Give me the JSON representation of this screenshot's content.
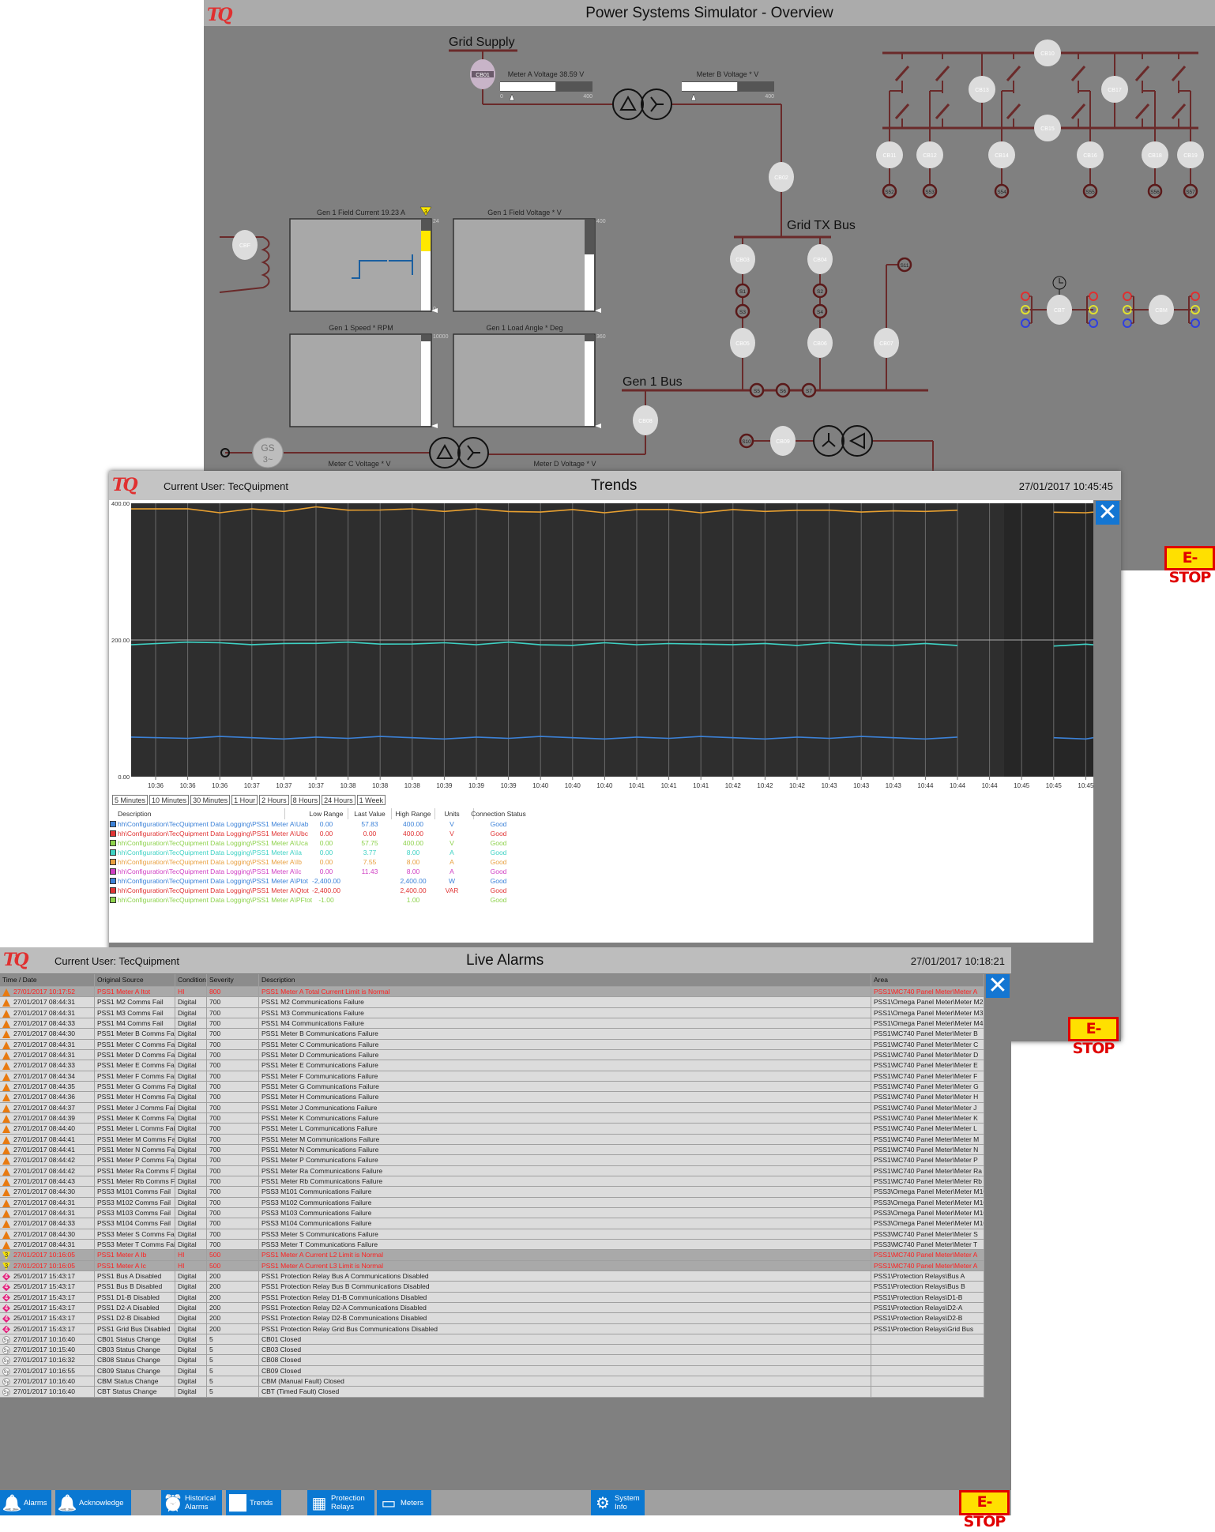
{
  "overview": {
    "logo": "TQ",
    "title": "Power Systems Simulator - Overview",
    "grid_supply_label": "Grid Supply",
    "grid_tx_bus_label": "Grid TX Bus",
    "gen1_bus_label": "Gen 1 Bus",
    "meter_a": {
      "label": "Meter A Voltage 38.59 V",
      "min": "0",
      "max": "400",
      "value": 38.59,
      "fill_fraction": 0.6
    },
    "meter_b": {
      "label": "Meter B Voltage * V",
      "min": "",
      "max": "400",
      "fill_fraction": 0.6
    },
    "meter_c_label": "Meter C Voltage * V",
    "meter_d_label": "Meter D Voltage * V",
    "generator_label": "GS",
    "generator_sub": "3~",
    "gen_panels": [
      {
        "title": "Gen 1 Field Current 19.23 A",
        "max": "24",
        "min": "0",
        "alarm_badge": "3"
      },
      {
        "title": "Gen 1 Field Voltage * V",
        "max": "400",
        "min": ""
      },
      {
        "title": "Gen 1 Speed * RPM",
        "max": "10000",
        "min": ""
      },
      {
        "title": "Gen 1 Load Angle * Deg",
        "max": "360",
        "min": ""
      }
    ],
    "breakers": [
      "CB01",
      "CB02",
      "CB03",
      "CB04",
      "CB05",
      "CB06",
      "CB07",
      "CB08",
      "CB09",
      "CBF",
      "CB10",
      "CB11",
      "CB12",
      "CB13",
      "CB14",
      "CB15",
      "CB16",
      "CB17",
      "CB18",
      "CB19",
      "CBT",
      "CBM"
    ],
    "switches": [
      "S1",
      "S2",
      "S3",
      "S4",
      "S5",
      "S6",
      "S7",
      "S10",
      "S11",
      "S52",
      "S53",
      "S54",
      "S55",
      "S56",
      "S57"
    ],
    "estop": "E-STOP",
    "colors": {
      "bus": "#6a2a2a",
      "breaker": "#dcdcdc",
      "background": "#808080"
    }
  },
  "trends": {
    "logo": "TQ",
    "current_user": "Current User: TecQuipment",
    "title": "Trends",
    "datetime": "27/01/2017 10:45:45",
    "time_buttons": [
      "5 Minutes",
      "10 Minutes",
      "30 Minutes",
      "1 Hour",
      "2 Hours",
      "8 Hours",
      "24 Hours",
      "1 Week"
    ],
    "legend_headers": [
      "Description",
      "Low Range",
      "Last Value",
      "High Range",
      "Units",
      "Connection Status"
    ],
    "legend": [
      {
        "color": "#3c82d8",
        "desc": "hh\\Configuration\\TecQuipment Data Logging\\PSS1 Meter A\\Uab",
        "low": "0.00",
        "last": "57.83",
        "high": "400.00",
        "units": "V",
        "status": "Good"
      },
      {
        "color": "#e03434",
        "desc": "hh\\Configuration\\TecQuipment Data Logging\\PSS1 Meter A\\Ubc",
        "low": "0.00",
        "last": "0.00",
        "high": "400.00",
        "units": "V",
        "status": "Good"
      },
      {
        "color": "#8ed24c",
        "desc": "hh\\Configuration\\TecQuipment Data Logging\\PSS1 Meter A\\Uca",
        "low": "0.00",
        "last": "57.75",
        "high": "400.00",
        "units": "V",
        "status": "Good"
      },
      {
        "color": "#3ed2c4",
        "desc": "hh\\Configuration\\TecQuipment Data Logging\\PSS1 Meter A\\Ia",
        "low": "0.00",
        "last": "3.77",
        "high": "8.00",
        "units": "A",
        "status": "Good"
      },
      {
        "color": "#e8a040",
        "desc": "hh\\Configuration\\TecQuipment Data Logging\\PSS1 Meter A\\Ib",
        "low": "0.00",
        "last": "7.55",
        "high": "8.00",
        "units": "A",
        "status": "Good"
      },
      {
        "color": "#d040c4",
        "desc": "hh\\Configuration\\TecQuipment Data Logging\\PSS1 Meter A\\Ic",
        "low": "0.00",
        "last": "11.43",
        "high": "8.00",
        "units": "A",
        "status": "Good"
      },
      {
        "color": "#3c82d8",
        "desc": "hh\\Configuration\\TecQuipment Data Logging\\PSS1 Meter A\\Ptot",
        "low": "-2,400.00",
        "last": "",
        "high": "2,400.00",
        "units": "W",
        "status": "Good"
      },
      {
        "color": "#e03434",
        "desc": "hh\\Configuration\\TecQuipment Data Logging\\PSS1 Meter A\\Qtot",
        "low": "-2,400.00",
        "last": "",
        "high": "2,400.00",
        "units": "VAR",
        "status": "Good"
      },
      {
        "color": "#8ed24c",
        "desc": "hh\\Configuration\\TecQuipment Data Logging\\PSS1 Meter A\\PFtot",
        "low": "-1.00",
        "last": "",
        "high": "1.00",
        "units": "",
        "status": "Good"
      }
    ],
    "estop": "E-STOP",
    "chart_data": {
      "type": "line",
      "ylim": [
        0,
        400
      ],
      "ytick_labels": [
        "400.00",
        "200.00",
        "0.00"
      ],
      "grid": true,
      "xtick_labels": [
        "10:36",
        "10:36",
        "10:36",
        "10:37",
        "10:37",
        "10:37",
        "10:38",
        "10:38",
        "10:38",
        "10:39",
        "10:39",
        "10:39",
        "10:40",
        "10:40",
        "10:40",
        "10:41",
        "10:41",
        "10:41",
        "10:42",
        "10:42",
        "10:42",
        "10:43",
        "10:43",
        "10:43",
        "10:44",
        "10:44",
        "10:44",
        "10:45",
        "10:45",
        "10:45"
      ],
      "series": [
        {
          "color": "#e8a030",
          "values": [
            390,
            392,
            388,
            391,
            389,
            393,
            390,
            392,
            391,
            389,
            390,
            388,
            389,
            390,
            387,
            389,
            391,
            388,
            390,
            389,
            388,
            390,
            389,
            388,
            389,
            388,
            null,
            null,
            386,
            387
          ]
        },
        {
          "color": "#3ed2c4",
          "values": [
            194,
            195,
            196,
            195,
            194,
            196,
            195,
            194,
            196,
            195,
            194,
            195,
            193,
            194,
            195,
            194,
            193,
            194,
            195,
            194,
            193,
            194,
            193,
            194,
            194,
            193,
            null,
            null,
            193,
            193
          ]
        },
        {
          "color": "#3c82d8",
          "values": [
            57,
            57,
            57,
            57,
            57,
            57,
            57,
            57,
            57,
            57,
            57,
            57,
            57,
            57,
            57,
            57,
            57,
            57,
            57,
            57,
            57,
            57,
            57,
            57,
            57,
            57,
            null,
            null,
            57,
            57
          ]
        }
      ]
    }
  },
  "alarms": {
    "logo": "TQ",
    "current_user": "Current User: TecQuipment",
    "title": "Live Alarms",
    "datetime": "27/01/2017 10:18:21",
    "headers": [
      "Time / Date",
      "Original Source",
      "Condition",
      "Severity",
      "Description",
      "Area"
    ],
    "rows": [
      [
        "warn",
        "27/01/2017 10:17:52",
        "PSS1 Meter A Itot",
        "HI",
        "800",
        "PSS1 Meter A Total Current Limit is Normal",
        "PSS1\\MC740 Panel Meter\\Meter A",
        1
      ],
      [
        "warn",
        "27/01/2017 08:44:31",
        "PSS1 M2 Comms Fail",
        "Digital",
        "700",
        "PSS1 M2 Communications Failure",
        "PSS1\\Omega Panel Meter\\Meter M2",
        0
      ],
      [
        "warn",
        "27/01/2017 08:44:31",
        "PSS1 M3 Comms Fail",
        "Digital",
        "700",
        "PSS1 M3 Communications Failure",
        "PSS1\\Omega Panel Meter\\Meter M3",
        0
      ],
      [
        "warn",
        "27/01/2017 08:44:33",
        "PSS1 M4 Comms Fail",
        "Digital",
        "700",
        "PSS1 M4 Communications Failure",
        "PSS1\\Omega Panel Meter\\Meter M4",
        0
      ],
      [
        "warn",
        "27/01/2017 08:44:30",
        "PSS1 Meter B Comms Fail",
        "Digital",
        "700",
        "PSS1 Meter B Communications Failure",
        "PSS1\\MC740 Panel Meter\\Meter B",
        0
      ],
      [
        "warn",
        "27/01/2017 08:44:31",
        "PSS1 Meter C Comms Fail",
        "Digital",
        "700",
        "PSS1 Meter C Communications Failure",
        "PSS1\\MC740 Panel Meter\\Meter C",
        0
      ],
      [
        "warn",
        "27/01/2017 08:44:31",
        "PSS1 Meter D Comms Fail",
        "Digital",
        "700",
        "PSS1 Meter D Communications Failure",
        "PSS1\\MC740 Panel Meter\\Meter D",
        0
      ],
      [
        "warn",
        "27/01/2017 08:44:33",
        "PSS1 Meter E Comms Fail",
        "Digital",
        "700",
        "PSS1 Meter E Communications Failure",
        "PSS1\\MC740 Panel Meter\\Meter E",
        0
      ],
      [
        "warn",
        "27/01/2017 08:44:34",
        "PSS1 Meter F Comms Fail",
        "Digital",
        "700",
        "PSS1 Meter F Communications Failure",
        "PSS1\\MC740 Panel Meter\\Meter F",
        0
      ],
      [
        "warn",
        "27/01/2017 08:44:35",
        "PSS1 Meter G Comms Fail",
        "Digital",
        "700",
        "PSS1 Meter G Communications Failure",
        "PSS1\\MC740 Panel Meter\\Meter G",
        0
      ],
      [
        "warn",
        "27/01/2017 08:44:36",
        "PSS1 Meter H Comms Fail",
        "Digital",
        "700",
        "PSS1 Meter H Communications Failure",
        "PSS1\\MC740 Panel Meter\\Meter H",
        0
      ],
      [
        "warn",
        "27/01/2017 08:44:37",
        "PSS1 Meter J Comms Fail",
        "Digital",
        "700",
        "PSS1 Meter J Communications Failure",
        "PSS1\\MC740 Panel Meter\\Meter J",
        0
      ],
      [
        "warn",
        "27/01/2017 08:44:39",
        "PSS1 Meter K Comms Fail",
        "Digital",
        "700",
        "PSS1 Meter K Communications Failure",
        "PSS1\\MC740 Panel Meter\\Meter K",
        0
      ],
      [
        "warn",
        "27/01/2017 08:44:40",
        "PSS1 Meter L Comms Fail",
        "Digital",
        "700",
        "PSS1 Meter L Communications Failure",
        "PSS1\\MC740 Panel Meter\\Meter L",
        0
      ],
      [
        "warn",
        "27/01/2017 08:44:41",
        "PSS1 Meter M Comms Fail",
        "Digital",
        "700",
        "PSS1 Meter M Communications Failure",
        "PSS1\\MC740 Panel Meter\\Meter M",
        0
      ],
      [
        "warn",
        "27/01/2017 08:44:41",
        "PSS1 Meter N Comms Fail",
        "Digital",
        "700",
        "PSS1 Meter N Communications Failure",
        "PSS1\\MC740 Panel Meter\\Meter N",
        0
      ],
      [
        "warn",
        "27/01/2017 08:44:42",
        "PSS1 Meter P Comms Fail",
        "Digital",
        "700",
        "PSS1 Meter P Communications Failure",
        "PSS1\\MC740 Panel Meter\\Meter P",
        0
      ],
      [
        "warn",
        "27/01/2017 08:44:42",
        "PSS1 Meter Ra Comms Fail",
        "Digital",
        "700",
        "PSS1 Meter Ra Communications Failure",
        "PSS1\\MC740 Panel Meter\\Meter Ra",
        0
      ],
      [
        "warn",
        "27/01/2017 08:44:43",
        "PSS1 Meter Rb Comms Fail",
        "Digital",
        "700",
        "PSS1 Meter Rb Communications Failure",
        "PSS1\\MC740 Panel Meter\\Meter Rb",
        0
      ],
      [
        "warn",
        "27/01/2017 08:44:30",
        "PSS3 M101 Comms Fail",
        "Digital",
        "700",
        "PSS3 M101 Communications Failure",
        "PSS3\\Omega Panel Meter\\Meter M101",
        0
      ],
      [
        "warn",
        "27/01/2017 08:44:31",
        "PSS3 M102 Comms Fail",
        "Digital",
        "700",
        "PSS3 M102 Communications Failure",
        "PSS3\\Omega Panel Meter\\Meter M102",
        0
      ],
      [
        "warn",
        "27/01/2017 08:44:31",
        "PSS3 M103 Comms Fail",
        "Digital",
        "700",
        "PSS3 M103 Communications Failure",
        "PSS3\\Omega Panel Meter\\Meter M103",
        0
      ],
      [
        "warn",
        "27/01/2017 08:44:33",
        "PSS3 M104 Comms Fail",
        "Digital",
        "700",
        "PSS3 M104 Communications Failure",
        "PSS3\\Omega Panel Meter\\Meter M104",
        0
      ],
      [
        "warn",
        "27/01/2017 08:44:30",
        "PSS3 Meter S Comms Fail",
        "Digital",
        "700",
        "PSS3 Meter S Communications Failure",
        "PSS3\\MC740 Panel Meter\\Meter S",
        0
      ],
      [
        "warn",
        "27/01/2017 08:44:31",
        "PSS3 Meter T Comms Fail",
        "Digital",
        "700",
        "PSS3 Meter T Communications Failure",
        "PSS3\\MC740 Panel Meter\\Meter T",
        0
      ],
      [
        "lvl3",
        "27/01/2017 10:16:05",
        "PSS1 Meter A Ib",
        "HI",
        "500",
        "PSS1 Meter A Current L2 Limit is Normal",
        "PSS1\\MC740 Panel Meter\\Meter A",
        1
      ],
      [
        "lvl3",
        "27/01/2017 10:16:05",
        "PSS1 Meter A Ic",
        "HI",
        "500",
        "PSS1 Meter A Current L3 Limit is Normal",
        "PSS1\\MC740 Panel Meter\\Meter A",
        1
      ],
      [
        "lvl4",
        "25/01/2017 15:43:17",
        "PSS1 Bus A Disabled",
        "Digital",
        "200",
        "PSS1 Protection Relay Bus A Communications Disabled",
        "PSS1\\Protection Relays\\Bus A",
        0
      ],
      [
        "lvl4",
        "25/01/2017 15:43:17",
        "PSS1 Bus B Disabled",
        "Digital",
        "200",
        "PSS1 Protection Relay Bus B Communications Disabled",
        "PSS1\\Protection Relays\\Bus B",
        0
      ],
      [
        "lvl4",
        "25/01/2017 15:43:17",
        "PSS1 D1-B Disabled",
        "Digital",
        "200",
        "PSS1 Protection Relay D1-B Communications Disabled",
        "PSS1\\Protection Relays\\D1-B",
        0
      ],
      [
        "lvl4",
        "25/01/2017 15:43:17",
        "PSS1 D2-A Disabled",
        "Digital",
        "200",
        "PSS1 Protection Relay D2-A Communications Disabled",
        "PSS1\\Protection Relays\\D2-A",
        0
      ],
      [
        "lvl4",
        "25/01/2017 15:43:17",
        "PSS1 D2-B Disabled",
        "Digital",
        "200",
        "PSS1 Protection Relay D2-B Communications Disabled",
        "PSS1\\Protection Relays\\D2-B",
        0
      ],
      [
        "lvl4",
        "25/01/2017 15:43:17",
        "PSS1 Grid Bus Disabled",
        "Digital",
        "200",
        "PSS1 Protection Relay Grid Bus Communications Disabled",
        "PSS1\\Protection Relays\\Grid Bus",
        0
      ],
      [
        "sys",
        "27/01/2017 10:16:40",
        "CB01 Status Change",
        "Digital",
        "5",
        "CB01 Closed",
        "",
        0
      ],
      [
        "sys",
        "27/01/2017 10:15:40",
        "CB03 Status Change",
        "Digital",
        "5",
        "CB03 Closed",
        "",
        0
      ],
      [
        "sys",
        "27/01/2017 10:16:32",
        "CB08 Status Change",
        "Digital",
        "5",
        "CB08 Closed",
        "",
        0
      ],
      [
        "sys",
        "27/01/2017 10:16:55",
        "CB09 Status Change",
        "Digital",
        "5",
        "CB09 Closed",
        "",
        0
      ],
      [
        "sys",
        "27/01/2017 10:16:40",
        "CBM Status Change",
        "Digital",
        "5",
        "CBM (Manual Fault) Closed",
        "",
        0
      ],
      [
        "sys",
        "27/01/2017 10:16:40",
        "CBT Status Change",
        "Digital",
        "5",
        "CBT (Timed Fault) Closed",
        "",
        0
      ]
    ],
    "icon_labels": {
      "lvl3": "3",
      "lvl4": "4",
      "sys": "Sy"
    },
    "estop": "E-STOP"
  },
  "toolbar": {
    "buttons": [
      {
        "id": "alarms",
        "label": "Alarms",
        "icon": "bell-icon"
      },
      {
        "id": "acknowledge",
        "label": "Acknowledge",
        "icon": "bell-outline-icon"
      },
      {
        "id": "historical-alarms",
        "label": "Historical Alarms",
        "icon": "alarm-clock-icon"
      },
      {
        "id": "trends",
        "label": "Trends",
        "icon": "trend-chart-icon"
      },
      {
        "id": "protection-relays",
        "label": "Protection Relays",
        "icon": "relay-panel-icon"
      },
      {
        "id": "meters",
        "label": "Meters",
        "icon": "meter-icon"
      },
      {
        "id": "system-info",
        "label": "System Info",
        "icon": "gear-icon"
      }
    ],
    "accent": "#0a78d2"
  }
}
